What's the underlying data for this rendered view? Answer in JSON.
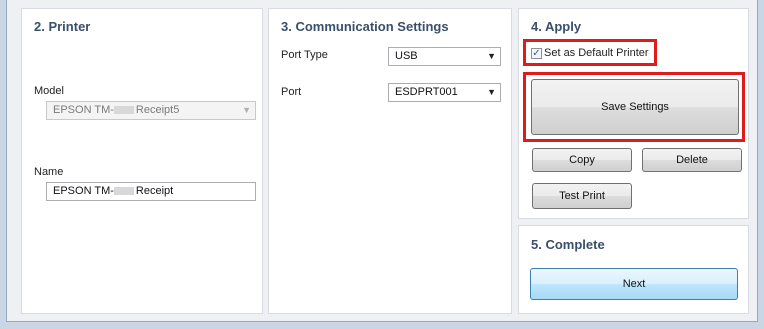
{
  "printer": {
    "heading": "2. Printer",
    "model_label": "Model",
    "model_value_prefix": "EPSON TM-",
    "model_value_suffix": "Receipt5",
    "name_label": "Name",
    "name_value_prefix": "EPSON TM-",
    "name_value_suffix": "Receipt"
  },
  "communication": {
    "heading": "3. Communication Settings",
    "port_type_label": "Port Type",
    "port_type_value": "USB",
    "port_label": "Port",
    "port_value": "ESDPRT001"
  },
  "apply": {
    "heading": "4. Apply",
    "default_checkbox_label": "Set as Default Printer",
    "default_checked": true,
    "save_label": "Save Settings",
    "copy_label": "Copy",
    "delete_label": "Delete",
    "test_print_label": "Test Print",
    "highlight_color": "#e11b1b"
  },
  "complete": {
    "heading": "5. Complete",
    "next_label": "Next"
  },
  "icons": {
    "dropdown": "chevron-down-icon",
    "check": "checkmark-icon"
  }
}
